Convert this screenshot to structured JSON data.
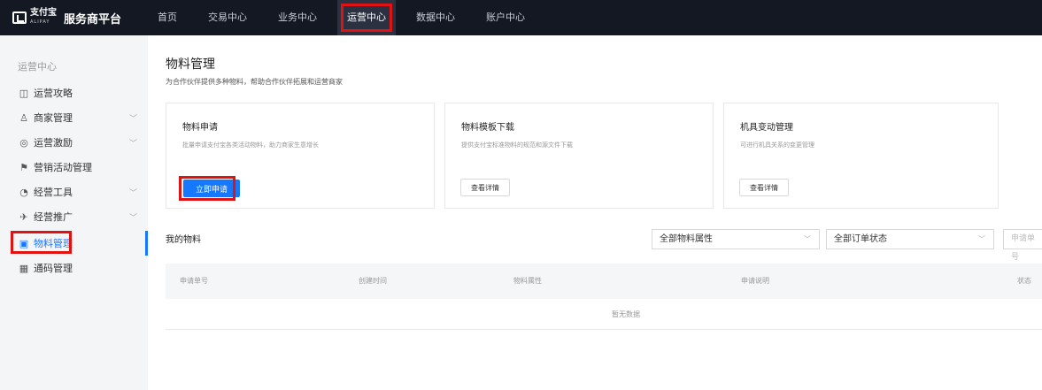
{
  "brand": {
    "mark": "支付宝",
    "mark_en": "ALIPAY",
    "title": "服务商平台"
  },
  "topnav": [
    {
      "label": "首页"
    },
    {
      "label": "交易中心"
    },
    {
      "label": "业务中心"
    },
    {
      "label": "运营中心",
      "active": true
    },
    {
      "label": "数据中心"
    },
    {
      "label": "账户中心"
    }
  ],
  "sidebar": {
    "header": "运营中心",
    "items": [
      {
        "label": "运营攻略",
        "icon": "book-icon",
        "glyph": "◫"
      },
      {
        "label": "商家管理",
        "icon": "users-icon",
        "glyph": "♙"
      },
      {
        "label": "运营激励",
        "icon": "wallet-icon",
        "glyph": "◎"
      },
      {
        "label": "营销活动管理",
        "icon": "ticket-icon",
        "glyph": "⚑"
      },
      {
        "label": "经营工具",
        "icon": "gauge-icon",
        "glyph": "◔"
      },
      {
        "label": "经营推广",
        "icon": "send-icon",
        "glyph": "✈"
      },
      {
        "label": "物料管理",
        "icon": "material-icon",
        "glyph": "▣"
      },
      {
        "label": "通码管理",
        "icon": "qrcode-icon",
        "glyph": "▦"
      }
    ]
  },
  "page": {
    "title": "物料管理",
    "subtitle": "为合作伙伴提供多种物料，帮助合作伙伴拓展和运营商家"
  },
  "cards": [
    {
      "title": "物料申请",
      "desc": "批量申请支付宝各类活动物料，助力商家生意增长",
      "button": "立即申请"
    },
    {
      "title": "物料模板下载",
      "desc": "提供支付宝标准物料的规范和源文件下载",
      "button": "查看详情"
    },
    {
      "title": "机具变动管理",
      "desc": "可进行机具关系的变更管理",
      "button": "查看详情"
    }
  ],
  "my_materials": {
    "label": "我的物料",
    "filter_attr": "全部物料属性",
    "filter_status": "全部订单状态",
    "search_placeholder": "申请单号",
    "columns": [
      "申请单号",
      "创建时间",
      "物料属性",
      "申请说明",
      "状态"
    ],
    "empty": "暂无数据"
  },
  "colors": {
    "accent": "#1677ff",
    "topbar": "#131823",
    "highlight": "#e01212"
  }
}
